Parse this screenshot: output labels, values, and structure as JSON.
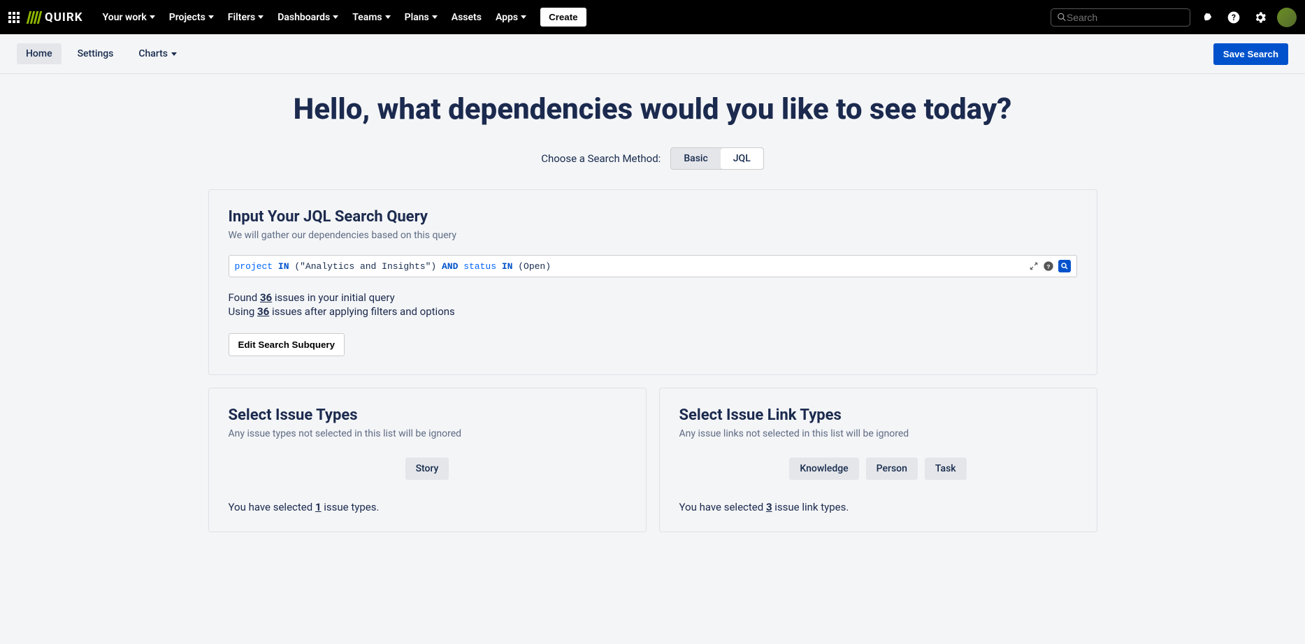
{
  "topnav": {
    "logo_text": "QUIRK",
    "items": [
      "Your work",
      "Projects",
      "Filters",
      "Dashboards",
      "Teams",
      "Plans",
      "Assets",
      "Apps"
    ],
    "items_has_chev": [
      true,
      true,
      true,
      true,
      true,
      true,
      false,
      true
    ],
    "create": "Create",
    "search_placeholder": "Search"
  },
  "subnav": {
    "tabs": [
      "Home",
      "Settings",
      "Charts"
    ],
    "tabs_has_chev": [
      false,
      false,
      true
    ],
    "active_index": 0,
    "save": "Save Search"
  },
  "hero": "Hello, what dependencies would you like to see today?",
  "method": {
    "label": "Choose a Search Method:",
    "options": [
      "Basic",
      "JQL"
    ],
    "selected_index": 1
  },
  "jql": {
    "title": "Input Your JQL Search Query",
    "sub": "We will gather our dependencies based on this query",
    "query_tokens": [
      {
        "t": "project",
        "c": "kw"
      },
      {
        "t": " "
      },
      {
        "t": "IN",
        "c": "op"
      },
      {
        "t": " (\"Analytics and Insights\") "
      },
      {
        "t": "AND",
        "c": "op"
      },
      {
        "t": " "
      },
      {
        "t": "status",
        "c": "kw"
      },
      {
        "t": " "
      },
      {
        "t": "IN",
        "c": "op"
      },
      {
        "t": " (Open)"
      }
    ],
    "found_prefix": "Found ",
    "found_count": "36",
    "found_suffix": " issues in your initial query",
    "using_prefix": "Using ",
    "using_count": "36",
    "using_suffix": " issues after applying filters and options",
    "edit_btn": "Edit Search Subquery"
  },
  "issue_types": {
    "title": "Select Issue Types",
    "sub": "Any issue types not selected in this list will be ignored",
    "chips": [
      "Story"
    ],
    "sel_prefix": "You have selected ",
    "sel_count": "1",
    "sel_suffix": " issue types."
  },
  "link_types": {
    "title": "Select Issue Link Types",
    "sub": "Any issue links not selected in this list will be ignored",
    "chips": [
      "Knowledge",
      "Person",
      "Task"
    ],
    "sel_prefix": "You have selected ",
    "sel_count": "3",
    "sel_suffix": " issue link types."
  }
}
